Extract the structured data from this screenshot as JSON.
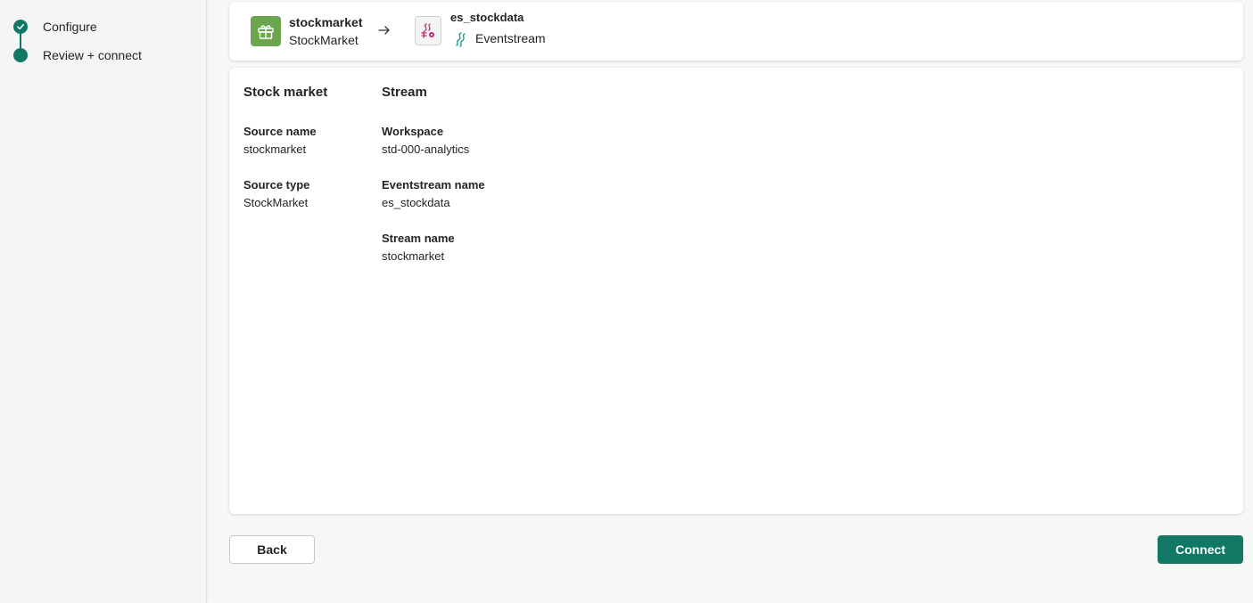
{
  "steps": [
    {
      "label": "Configure",
      "status": "completed"
    },
    {
      "label": "Review + connect",
      "status": "current"
    }
  ],
  "header": {
    "source": {
      "name": "stockmarket",
      "type": "StockMarket",
      "icon": "gift-icon"
    },
    "arrow_icon": "arrow-right-icon",
    "destination": {
      "name": "es_stockdata",
      "type": "Eventstream",
      "icon": "eventstream-icon"
    }
  },
  "details": {
    "left_column": {
      "title": "Stock market",
      "fields": [
        {
          "label": "Source name",
          "value": "stockmarket"
        },
        {
          "label": "Source type",
          "value": "StockMarket"
        }
      ]
    },
    "right_column": {
      "title": "Stream",
      "fields": [
        {
          "label": "Workspace",
          "value": "std-000-analytics"
        },
        {
          "label": "Eventstream name",
          "value": "es_stockdata"
        },
        {
          "label": "Stream name",
          "value": "stockmarket"
        }
      ]
    }
  },
  "buttons": {
    "back": "Back",
    "connect": "Connect"
  },
  "colors": {
    "accent": "#117865",
    "source_icon_bg": "#6ba64f",
    "eventstream_pink": "#c0287a",
    "eventstream_teal": "#1b9e8f"
  }
}
